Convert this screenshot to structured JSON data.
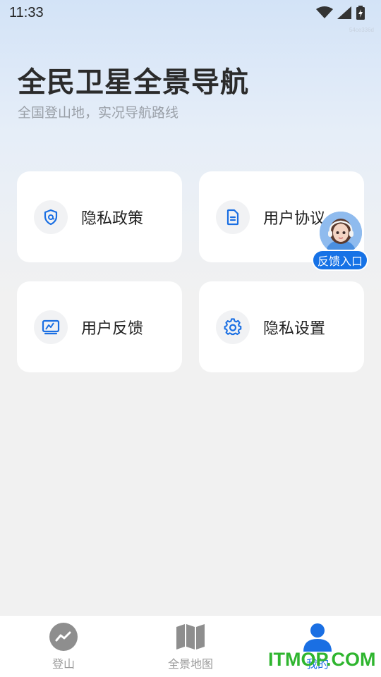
{
  "status_bar": {
    "time": "11:33",
    "icons": [
      "wifi-icon",
      "signal-icon",
      "battery-charging-icon"
    ],
    "build_id": "54ce336d"
  },
  "hero": {
    "title": "全民卫星全景导航",
    "subtitle": "全国登山地，实况导航路线"
  },
  "cards": [
    {
      "label": "隐私政策",
      "icon": "privacy-shield-icon"
    },
    {
      "label": "用户协议",
      "icon": "document-icon"
    },
    {
      "label": "用户反馈",
      "icon": "feedback-edit-icon"
    },
    {
      "label": "隐私设置",
      "icon": "gear-icon"
    }
  ],
  "feedback_entry": {
    "label": "反馈入口",
    "icon": "customer-service-avatar"
  },
  "tabbar": {
    "tabs": [
      {
        "label": "登山",
        "icon": "trend-icon",
        "active": false
      },
      {
        "label": "全景地图",
        "icon": "map-icon",
        "active": false
      },
      {
        "label": "我的",
        "icon": "user-icon",
        "active": true
      }
    ]
  },
  "watermark": "ITMOP.COM",
  "colors": {
    "accent": "#1a6fe3",
    "background": "#f1f1f1",
    "card": "#ffffff",
    "watermark": "#2fb52f"
  }
}
